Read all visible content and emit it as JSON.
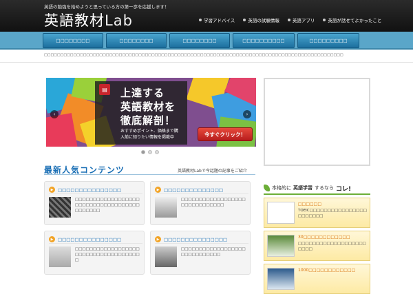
{
  "header": {
    "tagline": "英語の勉強を始めようと思っている方の第一歩を応援します！",
    "logo_text": "英語教材",
    "logo_suffix": "Lab",
    "top_nav": [
      {
        "label": "学習アドバイス"
      },
      {
        "label": "英語の試験情報"
      },
      {
        "label": "英語アプリ"
      },
      {
        "label": "英語が話せてよかったこと"
      }
    ]
  },
  "main_nav": [
    {
      "label": "□□□□□□□□"
    },
    {
      "label": "□□□□□□□□"
    },
    {
      "label": "□□□□□□□□"
    },
    {
      "label": "□□□□□□□□□□"
    },
    {
      "label": "□□□□□□□□□"
    }
  ],
  "breadcrumb": "□□□□□□□□□□□□□□□□□□□□□□□□□□□□□□□□□□□□□□□□□□□□□□□□□□□□□□□□□□□□□□□□□□□□□□□□□□□□□□□□□□□□□□□□□□□□",
  "slider": {
    "line1": "上達する",
    "line2": "英語教材を",
    "line3": "徹底解剖！",
    "desc1": "おすすめポイント、価格まで購",
    "desc2": "入前に知りたい情報を掲載中",
    "cta_label": "今すぐクリック！",
    "prev_label": "‹",
    "next_label": "›",
    "slide_count": 3,
    "active_index": 0
  },
  "section": {
    "title": "最新人気コンテンツ",
    "subtitle": "英語教材Labで今話題の記事をご紹介"
  },
  "cards": [
    {
      "title": "□□□□□□□□□□□□□□□",
      "text": "□□□□□□□□□□□□□□□□□□□□□□□□□□□□□□□□□□□□□□□□□□□"
    },
    {
      "title": "□□□□□□□□□□□□□□",
      "text": "□□□□□□□□□□□□□□□□□□□□□□□□□□□□□□"
    },
    {
      "title": "□□□□□□□□□□□□□□□",
      "text": "□□□□□□□□□□□□□□□□□□□□□□□□□□□□□□□□□□□□□"
    },
    {
      "title": "□□□□□□□□□□□□□□□",
      "text": "□□□□□□□□□□□□□□□□□□□□□□□□□□□□□"
    }
  ],
  "right": {
    "heading_pre": "本格的に",
    "heading_mid": "英語学習",
    "heading_post": "するなら",
    "heading_big": "コレ!",
    "items": [
      {
        "title": "□□□□□□",
        "text": "TOEIC□□□□□□□□□□□□□□□□□□□□□□□"
      },
      {
        "title": "30□□□□□□□□□□□□",
        "text": "□□□□□□□□□□□□□□□□□□□□□□□"
      },
      {
        "title": "1000□□□□□□□□□□□□",
        "text": ""
      }
    ]
  }
}
